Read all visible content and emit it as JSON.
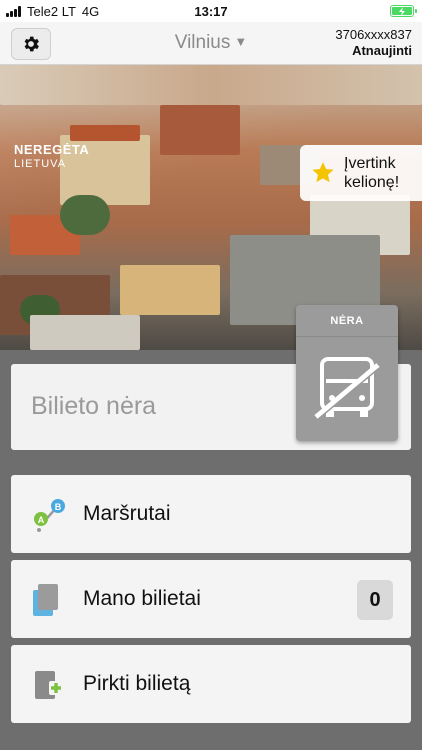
{
  "status_bar": {
    "carrier": "Tele2 LT",
    "network": "4G",
    "time": "13:17"
  },
  "header": {
    "city": "Vilnius",
    "phone": "3706xxxx837",
    "refresh_label": "Atnaujinti"
  },
  "hero": {
    "logo_line1": "NEREGĖTA",
    "logo_line2": "LIETUVA",
    "rate_label_line1": "Įvertink",
    "rate_label_line2": "kelionę!"
  },
  "ticket": {
    "status_label": "Bilieto nėra",
    "badge_label": "NĖRA"
  },
  "menu": {
    "routes_label": "Maršrutai",
    "my_tickets_label": "Mano bilietai",
    "my_tickets_count": "0",
    "buy_label": "Pirkti bilietą"
  },
  "icons": {
    "settings": "gear-icon",
    "star": "star-icon",
    "bus": "bus-crossed-icon",
    "routes": "route-ab-icon",
    "tickets": "tickets-icon",
    "buy": "buy-ticket-icon"
  },
  "colors": {
    "route_a": "#7ec142",
    "route_b": "#4aa8e0",
    "star": "#f5c400",
    "battery": "#4cd964"
  }
}
